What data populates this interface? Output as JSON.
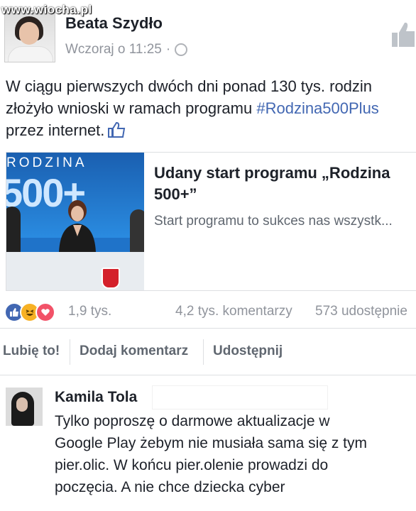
{
  "watermark": "www.wiocha.pl",
  "post": {
    "author": "Beata Szydło",
    "timestamp": "Wczoraj o 11:25",
    "separator": "·",
    "text_lines": {
      "line1": "W ciągu pierwszych dwóch dni ponad 130 tys. rodzin",
      "line2_before": "złożyło wnioski w ramach programu ",
      "hashtag": "#Rodzina500Plus",
      "line3": "przez internet."
    }
  },
  "link_card": {
    "image_word": "RODZINA",
    "image_number": "500+",
    "title": "Udany start programu „Rodzina 500+”",
    "description": "Start programu to sukces nas wszystk..."
  },
  "stats": {
    "reactions_count": "1,9 tys.",
    "comments": "4,2 tys. komentarzy",
    "shares": "573 udostępnie"
  },
  "actions": {
    "like": "Lubię to!",
    "comment": "Dodaj komentarz",
    "share": "Udostępnij"
  },
  "comment": {
    "author": "Kamila Tola",
    "lines": [
      "Tylko poproszę o darmowe aktualizacje w",
      "Google Play żebym nie musiała sama się z tym",
      "pier.olic. W końcu pier.olenie prowadzi do",
      "poczęcia. A nie chce dziecka cyber"
    ]
  },
  "colors": {
    "link_blue": "#4267b2",
    "meta_gray": "#90949c",
    "text": "#1d2129",
    "like_blue": "#4267b2",
    "haha_yellow": "#f7b125",
    "love_red": "#f25268"
  },
  "icons": [
    "globe-icon",
    "like-thumb-icon",
    "thumbs-up-emoji-icon",
    "like-reaction-icon",
    "haha-reaction-icon",
    "love-reaction-icon"
  ]
}
